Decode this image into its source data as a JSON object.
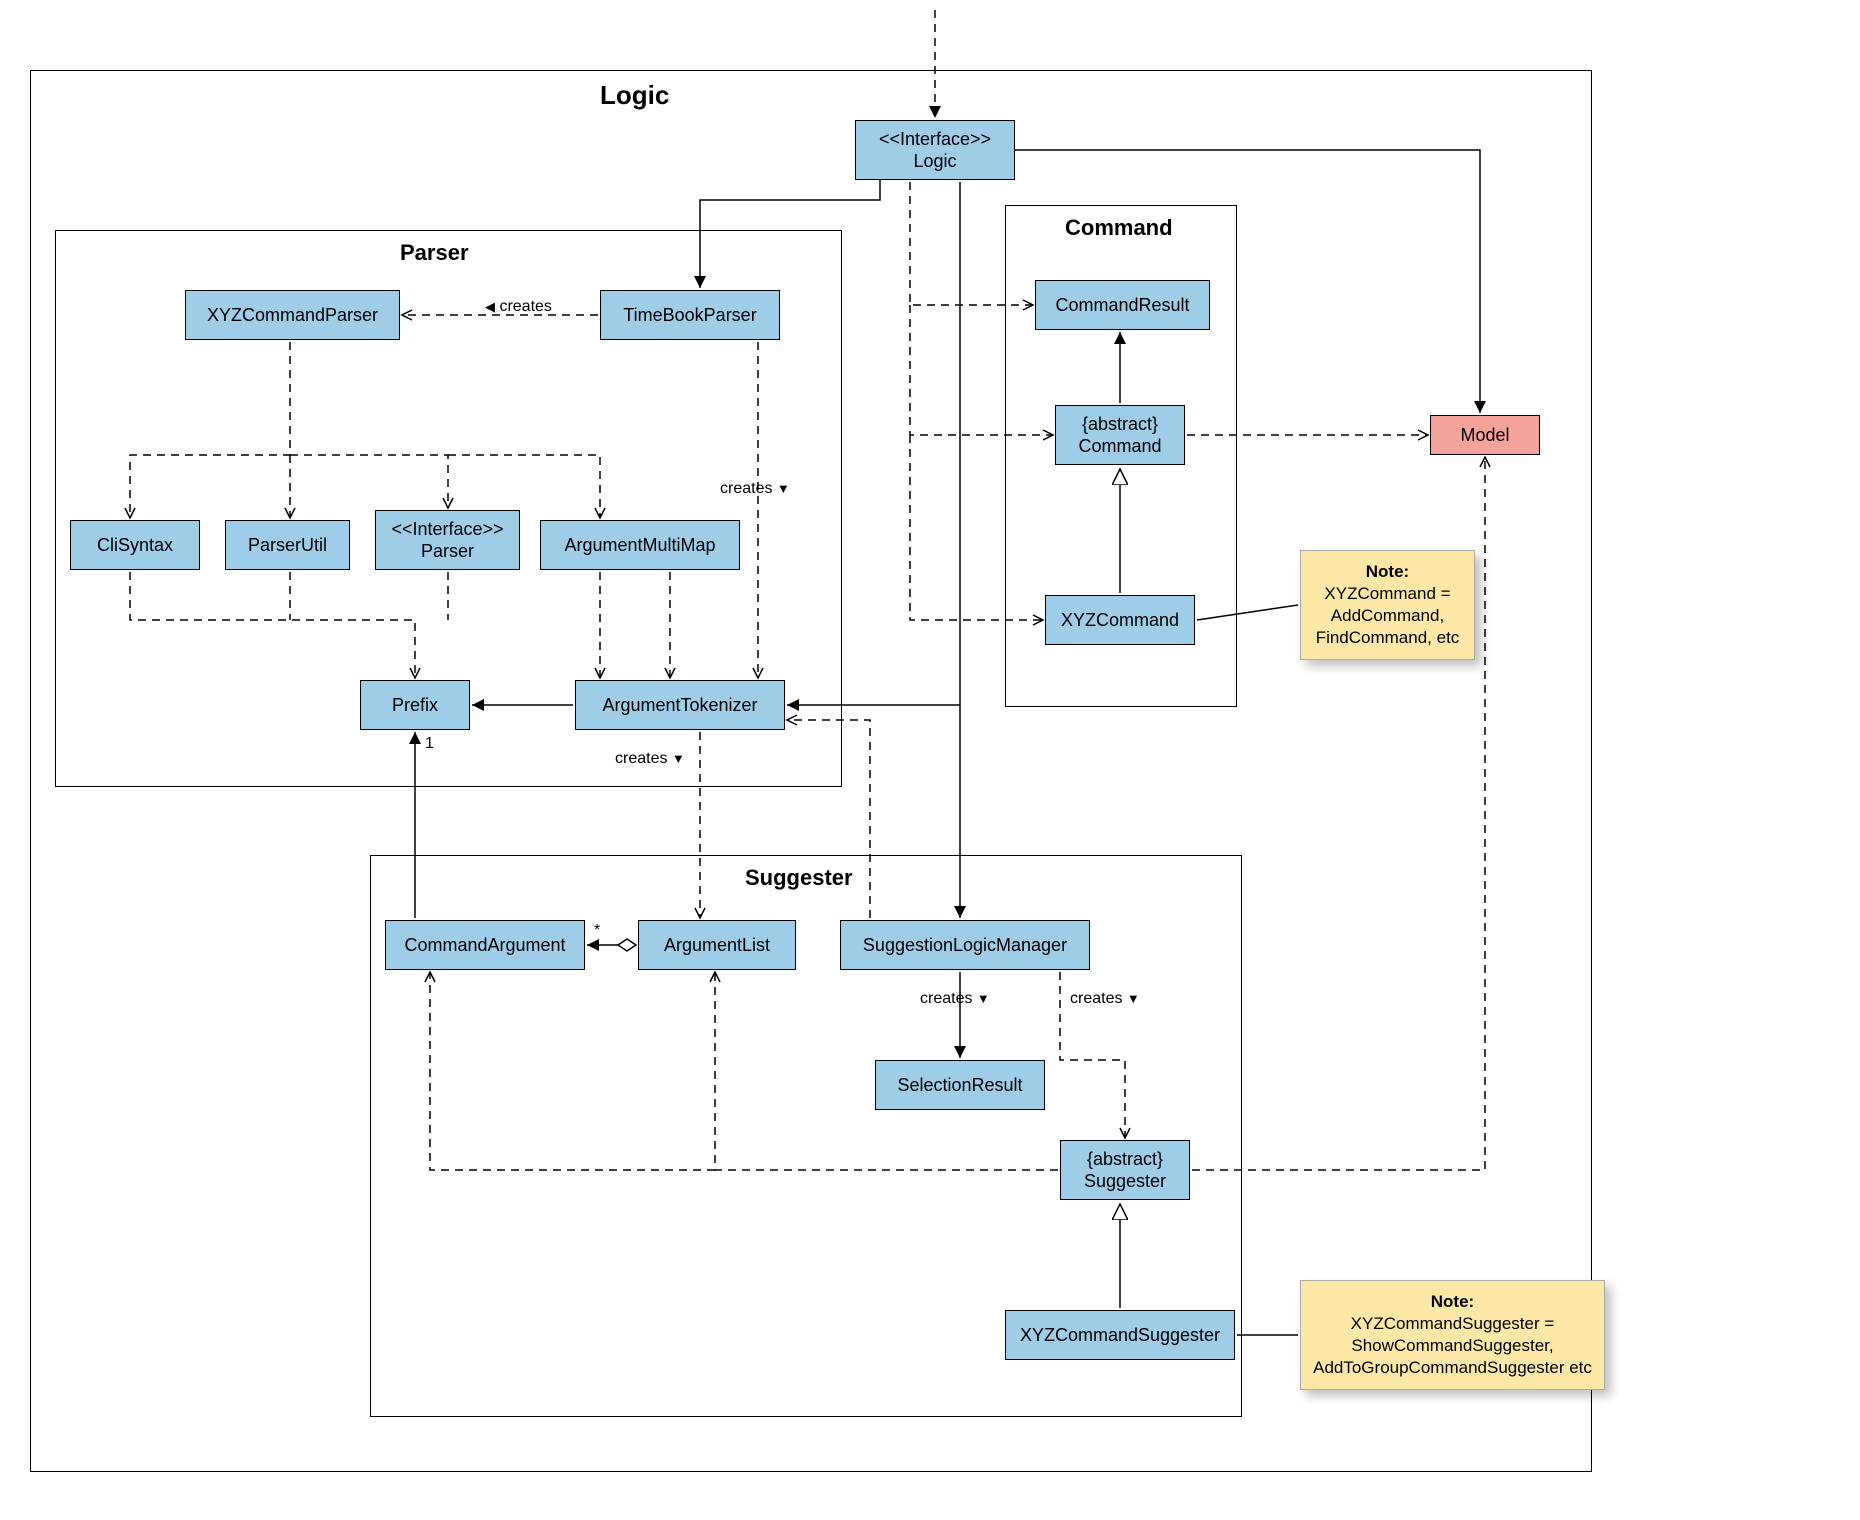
{
  "packages": {
    "logic": "Logic",
    "parser": "Parser",
    "command": "Command",
    "suggester": "Suggester"
  },
  "boxes": {
    "logic_if1": "<<Interface>>",
    "logic_if2": "Logic",
    "xyzcmdparser": "XYZCommandParser",
    "timebookparser": "TimeBookParser",
    "clisyntax": "CliSyntax",
    "parserutil": "ParserUtil",
    "parser_if1": "<<Interface>>",
    "parser_if2": "Parser",
    "argmmap": "ArgumentMultiMap",
    "prefix": "Prefix",
    "argtok": "ArgumentTokenizer",
    "cmdresult": "CommandResult",
    "abscmd1": "{abstract}",
    "abscmd2": "Command",
    "xyzcmd": "XYZCommand",
    "model": "Model",
    "cmdarg": "CommandArgument",
    "arglist": "ArgumentList",
    "slm": "SuggestionLogicManager",
    "selres": "SelectionResult",
    "abssug1": "{abstract}",
    "abssug2": "Suggester",
    "xyzsugg": "XYZCommandSuggester"
  },
  "labels": {
    "creates_xyzp": "creates",
    "creates_argtok": "creates",
    "creates_argtok2": "creates",
    "creates_selres": "creates",
    "creates_abssug": "creates",
    "mult_star": "*",
    "mult_one": "1"
  },
  "notes": {
    "n1_title": "Note:",
    "n1_body": "XYZCommand = AddCommand, FindCommand, etc",
    "n2_title": "Note:",
    "n2_body": "XYZCommandSuggester = ShowCommandSuggester, AddToGroupCommandSuggester etc"
  }
}
